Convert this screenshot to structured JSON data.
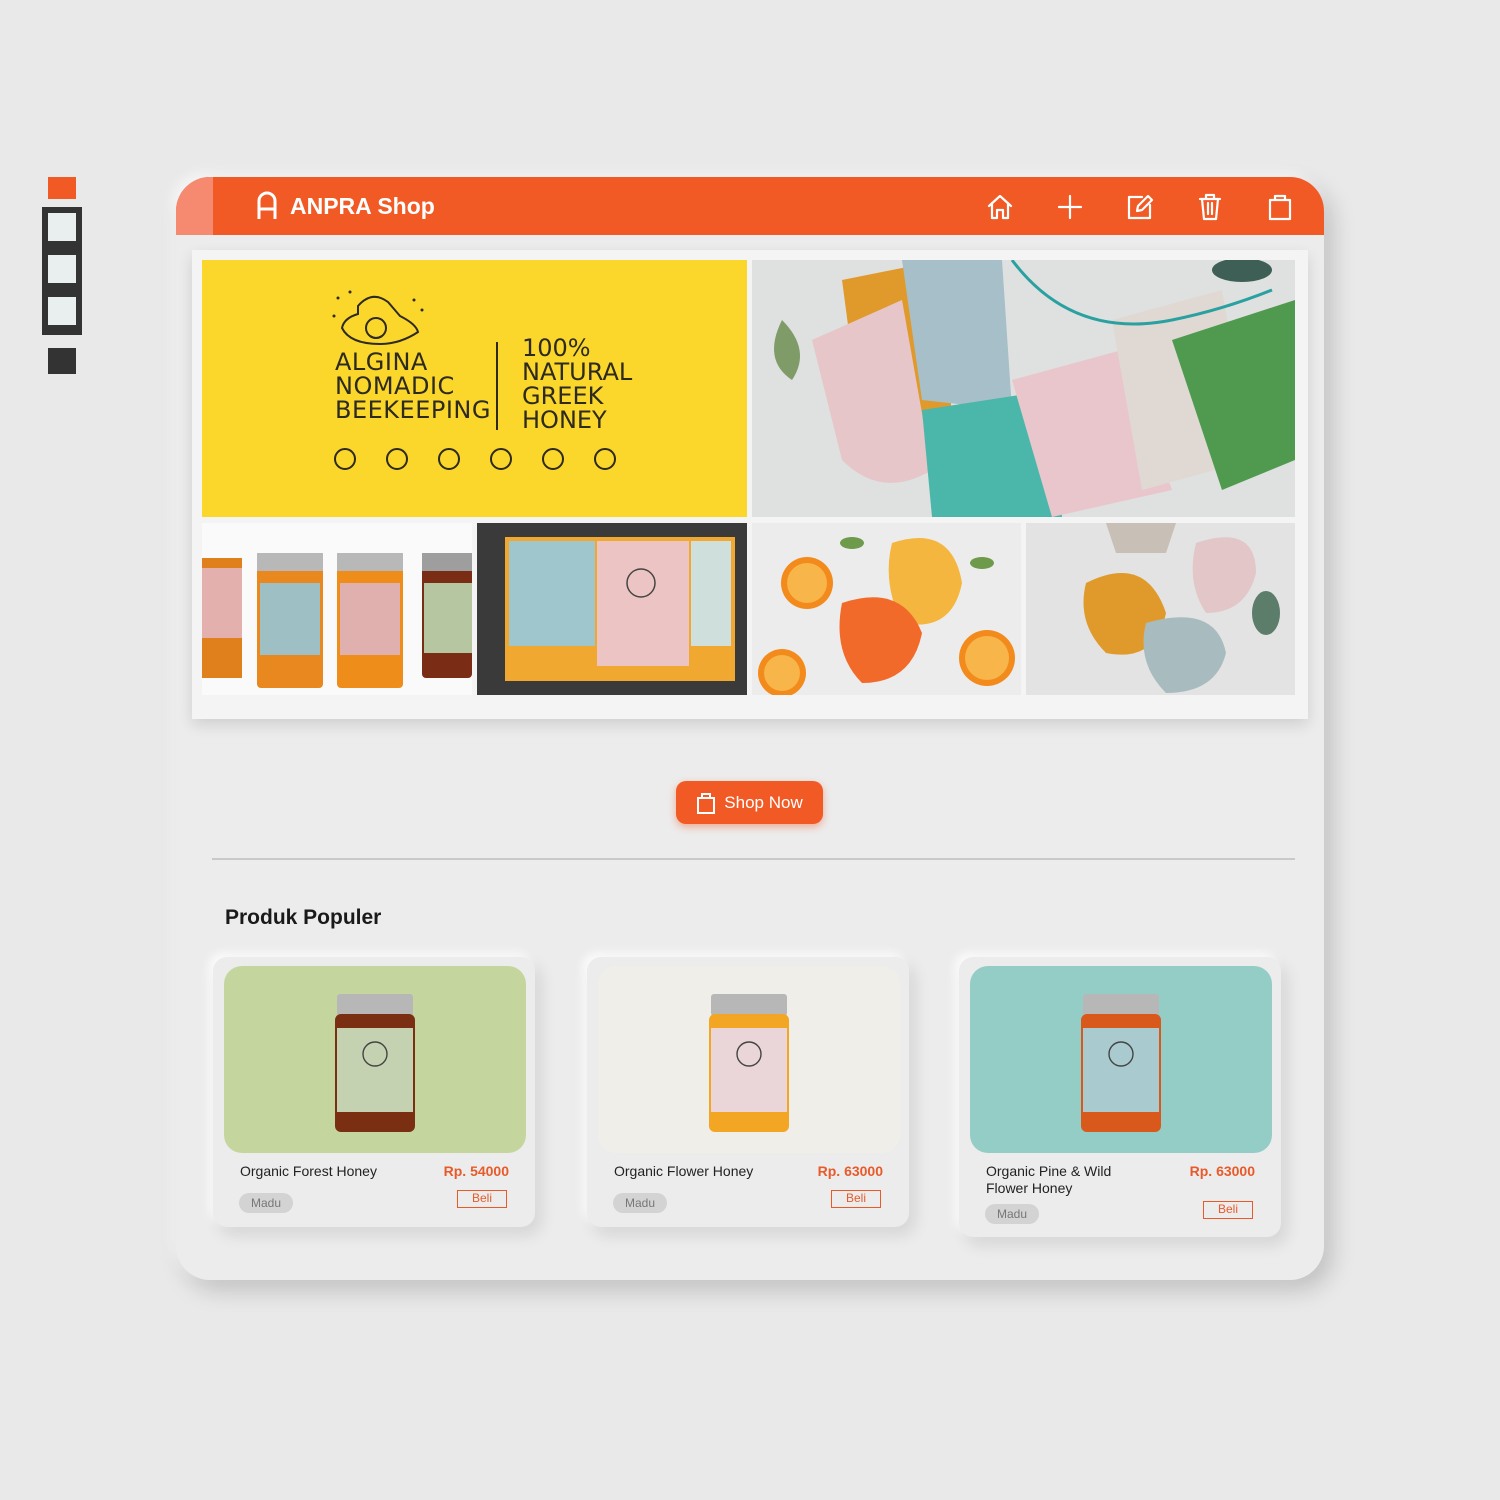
{
  "palette": {
    "colors": [
      "#f15a24",
      "#e9eeee",
      "#e9eeee",
      "#e9eeee",
      "#333333"
    ]
  },
  "header": {
    "title": "ANPRA Shop",
    "color": "#f15a24",
    "icons": [
      "home-icon",
      "plus-icon",
      "edit-icon",
      "trash-icon",
      "bag-icon"
    ]
  },
  "hero": {
    "banner": {
      "brand_lines": [
        "ALGINA",
        "NOMADIC",
        "BEEKEEPING"
      ],
      "tagline_lines": [
        "100%",
        "NATURAL",
        "GREEK",
        "HONEY"
      ],
      "background": "#fbd62b"
    }
  },
  "cta": {
    "label": "Shop Now"
  },
  "products": {
    "section_title": "Produk Populer",
    "items": [
      {
        "name": "Organic Forest Honey",
        "price": "Rp. 54000",
        "tag": "Madu",
        "action": "Beli",
        "bg": "#c4d69e",
        "honey": "#7a2e12"
      },
      {
        "name": "Organic Flower Honey",
        "price": "Rp. 63000",
        "tag": "Madu",
        "action": "Beli",
        "bg": "#efeee9",
        "honey": "#f2a624"
      },
      {
        "name": "Organic Pine & Wild Flower Honey",
        "price": "Rp. 63000",
        "tag": "Madu",
        "action": "Beli",
        "bg": "#93cdc5",
        "honey": "#d9581b"
      }
    ]
  }
}
